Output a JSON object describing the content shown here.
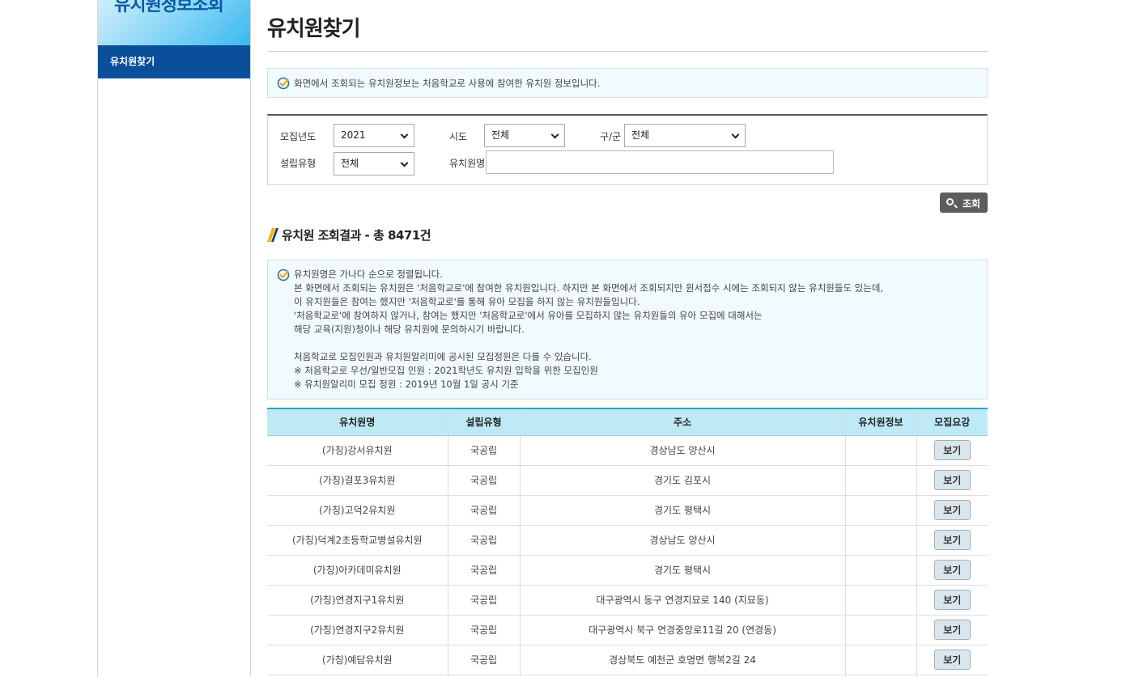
{
  "sidebar": {
    "header_title": "유치원정보조회",
    "active_item": "유치원찾기"
  },
  "page": {
    "title": "유치원찾기",
    "notice_top": "화면에서 조회되는 유치원정보는 처음학교로 사용에 참여한 유치원 정보입니다."
  },
  "search": {
    "year_label": "모집년도",
    "year_value": "2021",
    "sido_label": "시도",
    "sido_value": "전체",
    "gugun_label": "구/군",
    "gugun_value": "전체",
    "type_label": "설립유형",
    "type_value": "전체",
    "name_label": "유치원명",
    "name_value": "",
    "button_label": "조회"
  },
  "results": {
    "title": "유치원 조회결과 - 총 8471건",
    "notice_lines": [
      "유치원명은 가나다 순으로 정렬됩니다.",
      "본 화면에서 조회되는 유치원은 '처음학교로'에 참여한 유치원입니다. 하지만 본 화면에서 조회되지만 원서접수 시에는 조회되지 않는 유치원들도 있는데,",
      "이 유치원들은 참여는 했지만 '처음학교로'를 통해 유아 모집을 하지 않는 유치원들입니다.",
      "'처음학교로'에 참여하지 않거나, 참여는 했지만 '처음학교로'에서 유아를 모집하지 않는 유치원들의 유아 모집에 대해서는",
      "해당 교육(지원)청이나 해당 유치원에 문의하시기 바랍니다.",
      "",
      "처음학교로 모집인원과 유치원알리미에 공시된 모집정원은 다를 수 있습니다.",
      " ※ 처음학교로 우선/일반모집 인원 : 2021학년도 유치원 입학을 위한 모집인원",
      " ※ 유치원알리미 모집 정원 : 2019년 10월 1일 공시 기준"
    ]
  },
  "table": {
    "headers": [
      "유치원명",
      "설립유형",
      "주소",
      "유치원정보",
      "모집요강"
    ],
    "view_label": "보기",
    "rows": [
      {
        "name": "(가칭)강서유치원",
        "type": "국공립",
        "address": "경상남도 양산시",
        "info": ""
      },
      {
        "name": "(가칭)걸포3유치원",
        "type": "국공립",
        "address": "경기도 김포시",
        "info": ""
      },
      {
        "name": "(가칭)고덕2유치원",
        "type": "국공립",
        "address": "경기도 평택시",
        "info": ""
      },
      {
        "name": "(가칭)덕계2초등학교병설유치원",
        "type": "국공립",
        "address": "경상남도 양산시",
        "info": ""
      },
      {
        "name": "(가칭)아카데미유치원",
        "type": "국공립",
        "address": "경기도 평택시",
        "info": ""
      },
      {
        "name": "(가칭)연경지구1유치원",
        "type": "국공립",
        "address": "대구광역시 동구 연경지묘로 140  (지묘동)",
        "info": ""
      },
      {
        "name": "(가칭)연경지구2유치원",
        "type": "국공립",
        "address": "대구광역시 북구 연경중앙로11길 20  (연경동)",
        "info": ""
      },
      {
        "name": "(가칭)예담유치원",
        "type": "국공립",
        "address": "경상북도 예천군 호명면 행복2길 24",
        "info": ""
      },
      {
        "name": "",
        "type": "",
        "address": "",
        "info": ""
      }
    ]
  },
  "colors": {
    "sidebar_active": "#0a4f9a",
    "table_header_bg": "#bfeaf5",
    "table_header_border": "#26a7c0",
    "notice_bg": "#f1fafe",
    "search_button": "#5d5d5d",
    "check_icon": "#f5b400"
  }
}
